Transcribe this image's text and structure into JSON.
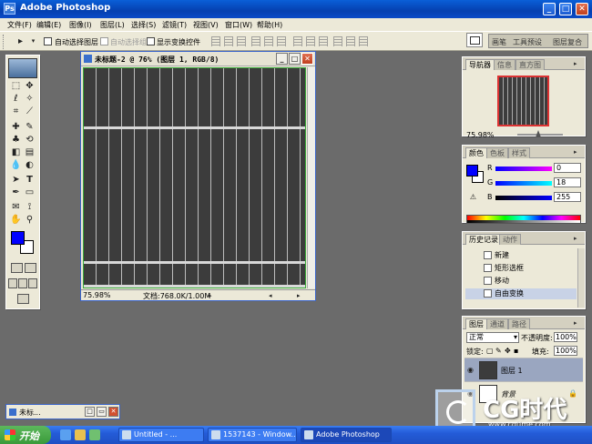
{
  "window": {
    "title": "Adobe Photoshop",
    "app_icon": "photoshop-icon",
    "controls": [
      "minimize",
      "maximize",
      "close"
    ]
  },
  "menu": [
    "文件(F)",
    "编辑(E)",
    "图像(I)",
    "图层(L)",
    "选择(S)",
    "滤镜(T)",
    "视图(V)",
    "窗口(W)",
    "帮助(H)"
  ],
  "options": {
    "auto_select_layer": "自动选择图层",
    "auto_select_group": "自动选择组",
    "show_transform": "显示变换控件",
    "well_tabs": [
      "画笔",
      "工具预设",
      "图层复合"
    ]
  },
  "document": {
    "title": "未标题-2 @ 76% (图层 1, RGB/8)",
    "zoom": "75.98%",
    "doc_size": "文档:768.0K/1.00M"
  },
  "navigator": {
    "tabs": [
      "导航器",
      "信息",
      "直方图"
    ],
    "zoom": "75.98%"
  },
  "color": {
    "tabs": [
      "颜色",
      "色板",
      "样式"
    ],
    "channels": [
      {
        "label": "R",
        "value": "0"
      },
      {
        "label": "G",
        "value": "18"
      },
      {
        "label": "B",
        "value": "255"
      }
    ],
    "foreground": "#0000ff"
  },
  "history": {
    "tabs": [
      "历史记录",
      "动作"
    ],
    "items": [
      "新建",
      "矩形选框",
      "移动",
      "自由变换"
    ],
    "active_index": 3
  },
  "layers": {
    "tabs": [
      "图层",
      "通道",
      "路径"
    ],
    "blend_mode": "正常",
    "opacity_label": "不透明度:",
    "opacity": "100%",
    "lock_label": "锁定:",
    "fill_label": "填充:",
    "fill": "100%",
    "items": [
      {
        "name": "图层 1",
        "active": true
      },
      {
        "name": "背景",
        "active": false
      }
    ]
  },
  "minimized_doc": {
    "title": "未标..."
  },
  "watermark": {
    "brand": "CG时代",
    "url": "www.cgtime.com"
  },
  "taskbar": {
    "start": "开始",
    "items": [
      {
        "label": "Untitled - ...",
        "active": false
      },
      {
        "label": "1537143 - Window...",
        "active": false
      },
      {
        "label": "Adobe Photoshop",
        "active": true
      }
    ]
  }
}
